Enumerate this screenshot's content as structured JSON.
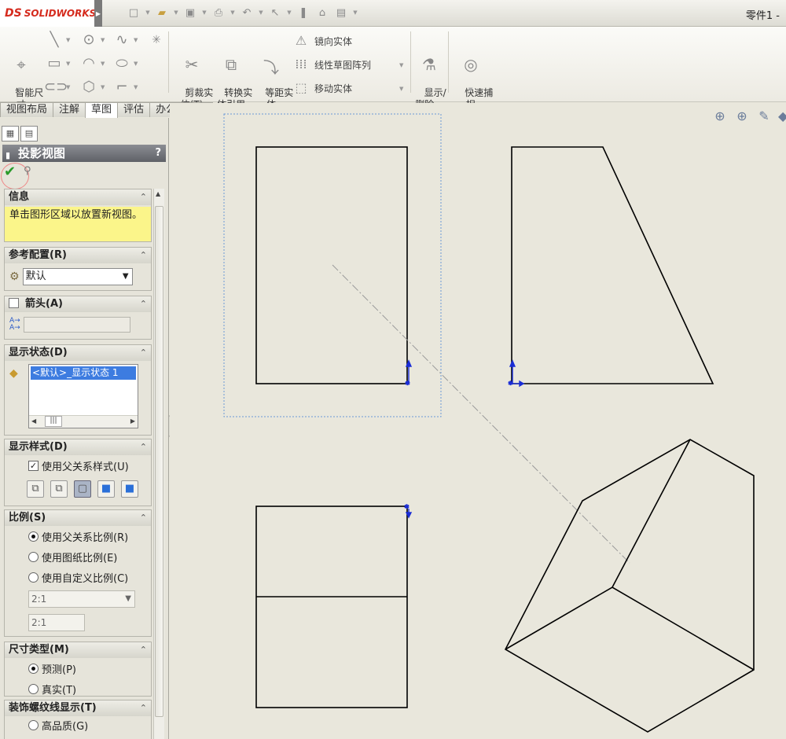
{
  "app": {
    "brand_mark": "DS",
    "brand_name": "SOLIDWORKS",
    "document_title": "零件1 -"
  },
  "quick_access": [
    "new-document-icon",
    "open-icon",
    "save-icon",
    "print-icon",
    "undo-icon",
    "select-icon",
    "rebuild-icon",
    "file-properties-icon",
    "options-icon"
  ],
  "ribbon": {
    "smart_dimension": "智能尺\n寸",
    "trim": "剪裁实\n体(T)",
    "convert": "转换实\n体引用",
    "offset": "等距实\n体",
    "mirror": "镜向实体",
    "linear_pattern": "线性草图阵列",
    "move": "移动实体",
    "display_delete": "显示/\n删除...",
    "quick_snap": "快速捕\n捉"
  },
  "tabs": [
    {
      "label": "视图布局",
      "active": false
    },
    {
      "label": "注解",
      "active": false
    },
    {
      "label": "草图",
      "active": true
    },
    {
      "label": "评估",
      "active": false
    },
    {
      "label": "办公室产品",
      "active": false
    }
  ],
  "property_manager": {
    "title": "投影视图",
    "help": "?",
    "groups": {
      "info": {
        "label": "信息",
        "text": "单击图形区域以放置新视图。"
      },
      "ref_config": {
        "label": "参考配置(R)",
        "value": "默认"
      },
      "arrow": {
        "label": "箭头(A)"
      },
      "display_state": {
        "label": "显示状态(D)",
        "selected": "<默认>_显示状态 1",
        "scroll_thumb": "|||"
      },
      "display_style": {
        "label": "显示样式(D)",
        "use_parent": "使用父关系样式(U)"
      },
      "scale": {
        "label": "比例(S)",
        "opt1": "使用父关系比例(R)",
        "opt2": "使用图纸比例(E)",
        "opt3": "使用自定义比例(C)",
        "combo": "2:1",
        "field": "2:1"
      },
      "dim_type": {
        "label": "尺寸类型(M)",
        "opt1": "预测(P)",
        "opt2": "真实(T)"
      },
      "cosmetic": {
        "label": "装饰螺纹线显示(T)",
        "opt1": "高品质(G)"
      }
    }
  },
  "colors": {
    "canvas_bg": "#e9e7dc",
    "line": "#000000",
    "sketch_blue": "#1a2dd6",
    "selection_box": "#6a9ad6",
    "info_yellow": "#fbf58a"
  }
}
